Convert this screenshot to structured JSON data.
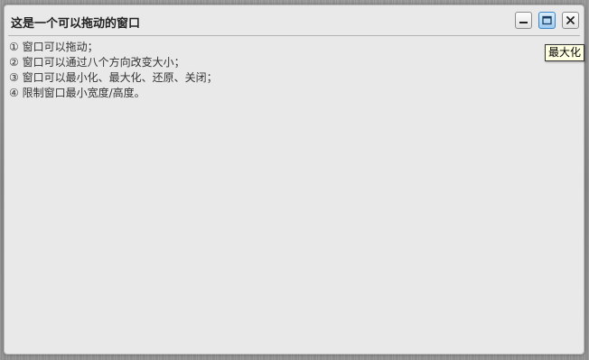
{
  "window": {
    "title": "这是一个可以拖动的窗口",
    "controls": {
      "minimize_icon": "minimize-icon",
      "maximize_icon": "maximize-icon",
      "close_icon": "close-icon"
    },
    "tooltip": "最大化",
    "content": {
      "lines": [
        "① 窗口可以拖动；",
        "② 窗口可以通过八个方向改变大小；",
        "③ 窗口可以最小化、最大化、还原、关闭；",
        "④ 限制窗口最小宽度/高度。"
      ]
    }
  },
  "colors": {
    "window_bg": "#e9e9e9",
    "maximize_active": "#3c85c8",
    "tooltip_bg": "#ffffe1"
  }
}
